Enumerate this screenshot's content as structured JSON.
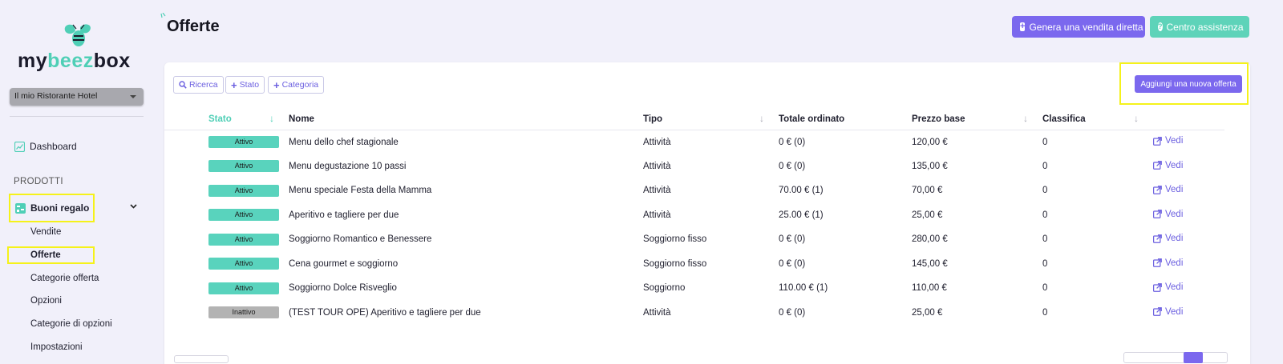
{
  "brand": {
    "logo_main": "my",
    "logo_accent": "beez",
    "logo_tail": "box"
  },
  "hotel_select": {
    "value": "Il mio Ristorante Hotel"
  },
  "sidebar": {
    "dashboard": "Dashboard",
    "section_products": "PRODOTTI",
    "buoni_regalo": "Buoni regalo",
    "sub_items": [
      "Vendite",
      "Offerte",
      "Categorie offerta",
      "Opzioni",
      "Categorie di opzioni",
      "Impostazioni"
    ]
  },
  "header": {
    "title": "Offerte",
    "btn_direct_sale": "Genera una vendita diretta",
    "btn_help": "Centro assistenza"
  },
  "filters": {
    "search": "Ricerca",
    "status": "Stato",
    "category": "Categoria"
  },
  "add_offer": "Aggiungi una nuova offerta",
  "table": {
    "columns": [
      "Stato",
      "Nome",
      "Tipo",
      "Totale ordinato",
      "Prezzo base",
      "Classifica"
    ],
    "view_label": "Vedi",
    "rows": [
      {
        "status": "Attivo",
        "active": true,
        "name": "Menu dello chef stagionale",
        "type": "Attività",
        "total": "0 € (0)",
        "price": "120,00 €",
        "rank": "0"
      },
      {
        "status": "Attivo",
        "active": true,
        "name": "Menu degustazione 10 passi",
        "type": "Attività",
        "total": "0 € (0)",
        "price": "135,00 €",
        "rank": "0"
      },
      {
        "status": "Attivo",
        "active": true,
        "name": "Menu speciale Festa della Mamma",
        "type": "Attività",
        "total": "70.00 € (1)",
        "price": "70,00 €",
        "rank": "0"
      },
      {
        "status": "Attivo",
        "active": true,
        "name": "Aperitivo e tagliere per due",
        "type": "Attività",
        "total": "25.00 € (1)",
        "price": "25,00 €",
        "rank": "0"
      },
      {
        "status": "Attivo",
        "active": true,
        "name": "Soggiorno Romantico e Benessere",
        "type": "Soggiorno fisso",
        "total": "0 € (0)",
        "price": "280,00 €",
        "rank": "0"
      },
      {
        "status": "Attivo",
        "active": true,
        "name": "Cena gourmet e soggiorno",
        "type": "Soggiorno fisso",
        "total": "0 € (0)",
        "price": "145,00 €",
        "rank": "0"
      },
      {
        "status": "Attivo",
        "active": true,
        "name": "Soggiorno Dolce Risveglio",
        "type": "Soggiorno",
        "total": "110.00 € (1)",
        "price": "110,00 €",
        "rank": "0"
      },
      {
        "status": "Inattivo",
        "active": false,
        "name": "(TEST TOUR OPE) Aperitivo e tagliere per due",
        "type": "Attività",
        "total": "0 € (0)",
        "price": "25,00 €",
        "rank": "0"
      }
    ]
  }
}
